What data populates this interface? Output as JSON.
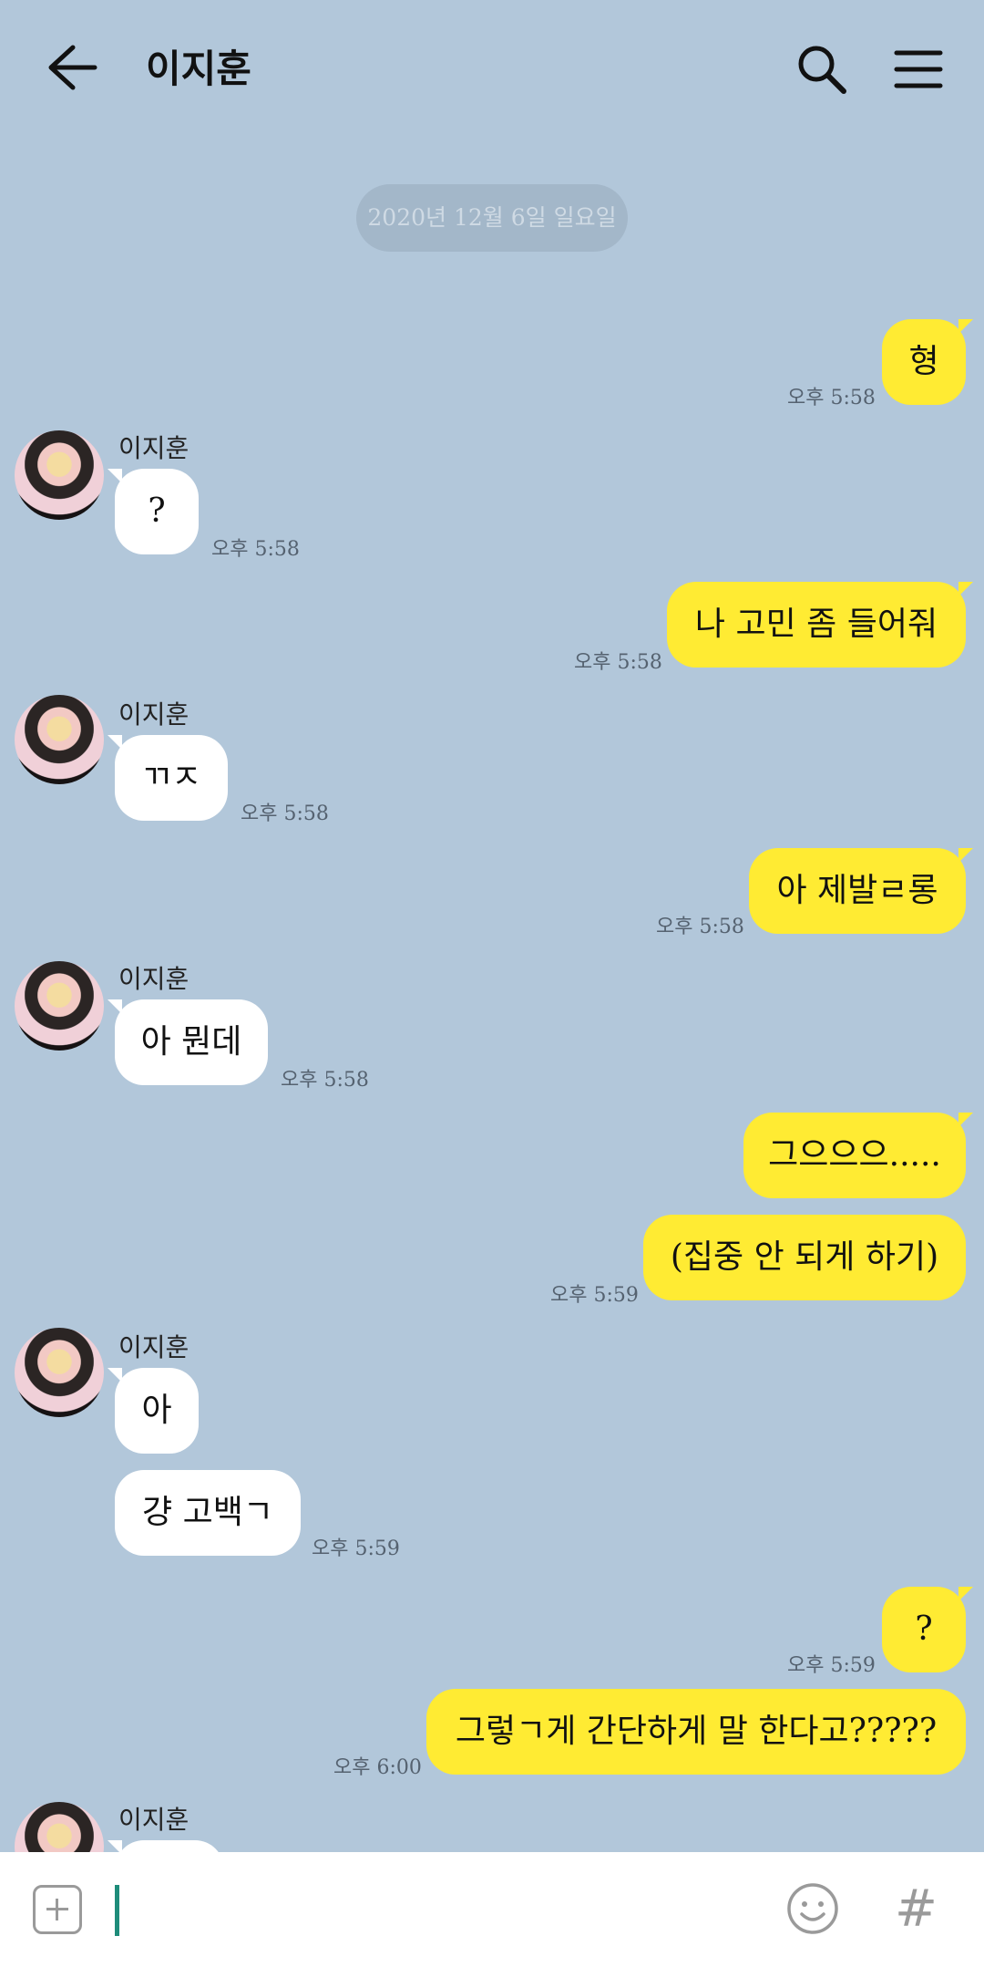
{
  "header": {
    "title": "이지훈"
  },
  "date_divider": "2020년 12월 6일 일요일",
  "contact_name": "이지훈",
  "messages": [
    {
      "from": "me",
      "text": "형",
      "time": "오후 5:58"
    },
    {
      "from": "them",
      "text": "?",
      "time": "오후 5:58"
    },
    {
      "from": "me",
      "text": "나 고민 좀 들어줘",
      "time": "오후 5:58"
    },
    {
      "from": "them",
      "text": "ㄲㅈ",
      "time": "오후 5:58"
    },
    {
      "from": "me",
      "text": "아 제발ㄹ롱",
      "time": "오후 5:58"
    },
    {
      "from": "them",
      "text": "아 뭔데",
      "time": "오후 5:58"
    },
    {
      "from": "me",
      "text": "그으으으.....",
      "time": ""
    },
    {
      "from": "me",
      "text": "(집중 안 되게 하기)",
      "time": "오후 5:59"
    },
    {
      "from": "them",
      "text": "아",
      "time": ""
    },
    {
      "from": "them",
      "text": "걍 고백ㄱ",
      "time": "오후 5:59"
    },
    {
      "from": "me",
      "text": "?",
      "time": "오후 5:59"
    },
    {
      "from": "me",
      "text": "그렇ㄱ게 간단하게 말 한다고?????",
      "time": "오후 6:00"
    }
  ],
  "composer": {
    "value": "",
    "hash_label": "#"
  }
}
